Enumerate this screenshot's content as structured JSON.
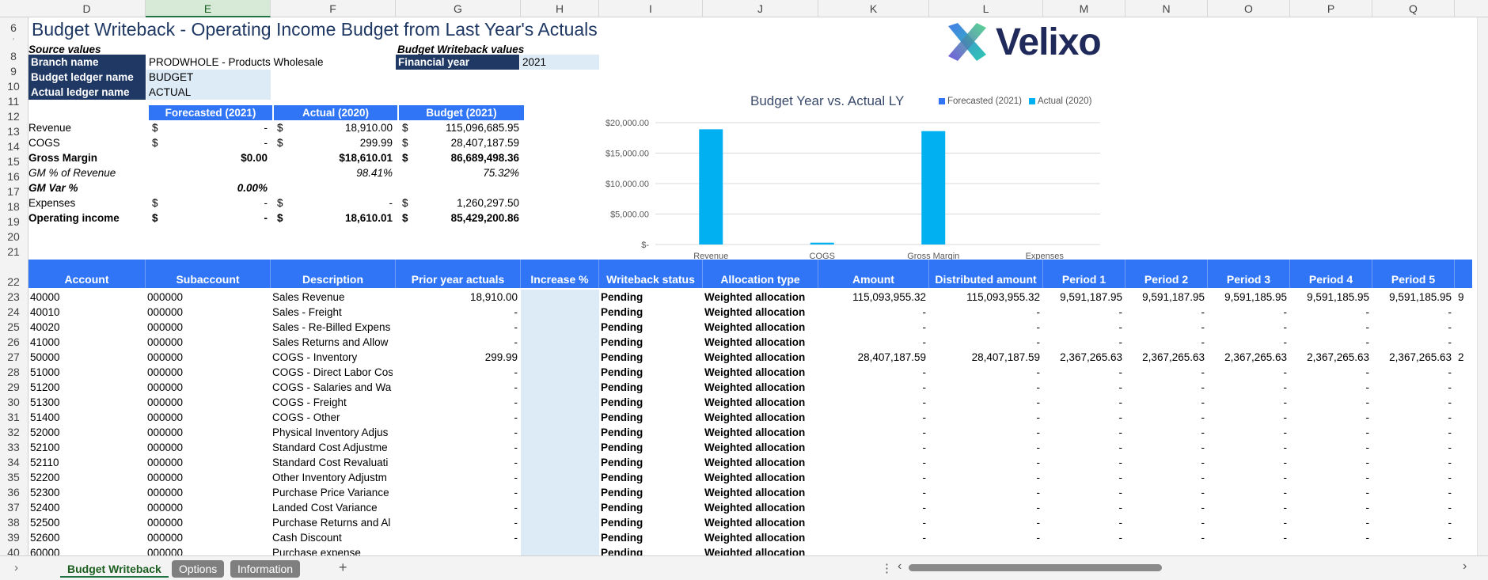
{
  "columns": [
    "D",
    "E",
    "F",
    "G",
    "H",
    "I",
    "J",
    "K",
    "L",
    "M",
    "N",
    "O",
    "P",
    "Q"
  ],
  "rows": [
    "6",
    "7",
    "8",
    "9",
    "10",
    "11",
    "12",
    "13",
    "14",
    "15",
    "16",
    "17",
    "18",
    "19",
    "20",
    "21",
    "22",
    "23",
    "24",
    "25",
    "26",
    "27",
    "28",
    "29",
    "30",
    "31",
    "32",
    "33",
    "34",
    "35",
    "36",
    "37",
    "38",
    "39",
    "40"
  ],
  "title": "Budget Writeback - Operating Income Budget from Last Year's Actuals",
  "logo": {
    "text": "Velixo"
  },
  "source": {
    "heading": "Source values",
    "branch_label": "Branch name",
    "branch_value": "PRODWHOLE - Products Wholesale",
    "budget_ledger_label": "Budget ledger name",
    "budget_ledger_value": "BUDGET",
    "actual_ledger_label": "Actual ledger name",
    "actual_ledger_value": "ACTUAL"
  },
  "writeback": {
    "heading": "Budget Writeback values",
    "fy_label": "Financial year",
    "fy_value": "2021"
  },
  "summary": {
    "headers": [
      "Forecasted (2021)",
      "Actual (2020)",
      "Budget (2021)"
    ],
    "rows": [
      {
        "label": "Revenue",
        "f_cur": "$",
        "f": "-",
        "a_cur": "$",
        "a": "18,910.00",
        "b_cur": "$",
        "b": "115,096,685.95",
        "bold": false,
        "italic": false
      },
      {
        "label": "COGS",
        "f_cur": "$",
        "f": "-",
        "a_cur": "$",
        "a": "299.99",
        "b_cur": "$",
        "b": "28,407,187.59",
        "bold": false,
        "italic": false
      },
      {
        "label": "Gross Margin",
        "f_cur": "",
        "f": "$0.00",
        "a_cur": "",
        "a": "$18,610.01",
        "b_cur": "$",
        "b": "86,689,498.36",
        "bold": true,
        "italic": false
      },
      {
        "label": "GM % of Revenue",
        "f_cur": "",
        "f": "",
        "a_cur": "",
        "a": "98.41%",
        "b_cur": "",
        "b": "75.32%",
        "bold": false,
        "italic": true
      },
      {
        "label": "GM Var %",
        "f_cur": "",
        "f": "0.00%",
        "a_cur": "",
        "a": "",
        "b_cur": "",
        "b": "",
        "bold": true,
        "italic": true
      },
      {
        "label": "Expenses",
        "f_cur": "$",
        "f": "-",
        "a_cur": "$",
        "a": "-",
        "b_cur": "$",
        "b": "1,260,297.50",
        "bold": false,
        "italic": false
      },
      {
        "label": "Operating income",
        "f_cur": "$",
        "f": "-",
        "a_cur": "$",
        "a": "18,610.01",
        "b_cur": "$",
        "b": "85,429,200.86",
        "bold": true,
        "italic": false
      }
    ]
  },
  "chart_data": {
    "type": "bar",
    "title": "Budget Year vs. Actual LY",
    "categories": [
      "Revenue",
      "COGS",
      "Gross Margin",
      "Expenses"
    ],
    "series": [
      {
        "name": "Forecasted (2021)",
        "values": [
          0,
          0,
          0,
          0
        ],
        "color": "#2f75f5"
      },
      {
        "name": "Actual (2020)",
        "values": [
          18910.0,
          299.99,
          18610.01,
          0
        ],
        "color": "#00b0f0"
      }
    ],
    "y_ticks": [
      "$20,000.00",
      "$15,000.00",
      "$10,000.00",
      "$5,000.00",
      "$-"
    ],
    "ylim": [
      0,
      20000
    ],
    "legend": "top-right",
    "grid": true
  },
  "table": {
    "headers": [
      "Account",
      "Subaccount",
      "Description",
      "Prior year actuals",
      "Increase %",
      "Writeback status",
      "Allocation type",
      "Amount",
      "Distributed amount",
      "Period 1",
      "Period 2",
      "Period 3",
      "Period 4",
      "Period 5"
    ],
    "rows": [
      [
        "40000",
        "000000",
        "Sales Revenue",
        "18,910.00",
        "",
        "Pending",
        "Weighted allocation",
        "115,093,955.32",
        "115,093,955.32",
        "9,591,187.95",
        "9,591,187.95",
        "9,591,185.95",
        "9,591,185.95",
        "9,591,185.95"
      ],
      [
        "40010",
        "000000",
        "Sales - Freight",
        "-",
        "",
        "Pending",
        "Weighted allocation",
        "-",
        "-",
        "-",
        "-",
        "-",
        "-",
        "-"
      ],
      [
        "40020",
        "000000",
        "Sales - Re-Billed Expens",
        "-",
        "",
        "Pending",
        "Weighted allocation",
        "-",
        "-",
        "-",
        "-",
        "-",
        "-",
        "-"
      ],
      [
        "41000",
        "000000",
        "Sales Returns and Allow",
        "-",
        "",
        "Pending",
        "Weighted allocation",
        "-",
        "-",
        "-",
        "-",
        "-",
        "-",
        "-"
      ],
      [
        "50000",
        "000000",
        "COGS - Inventory",
        "299.99",
        "",
        "Pending",
        "Weighted allocation",
        "28,407,187.59",
        "28,407,187.59",
        "2,367,265.63",
        "2,367,265.63",
        "2,367,265.63",
        "2,367,265.63",
        "2,367,265.63"
      ],
      [
        "51000",
        "000000",
        "COGS - Direct Labor Cos",
        "-",
        "",
        "Pending",
        "Weighted allocation",
        "-",
        "-",
        "-",
        "-",
        "-",
        "-",
        "-"
      ],
      [
        "51200",
        "000000",
        "COGS - Salaries and Wa",
        "-",
        "",
        "Pending",
        "Weighted allocation",
        "-",
        "-",
        "-",
        "-",
        "-",
        "-",
        "-"
      ],
      [
        "51300",
        "000000",
        "COGS - Freight",
        "-",
        "",
        "Pending",
        "Weighted allocation",
        "-",
        "-",
        "-",
        "-",
        "-",
        "-",
        "-"
      ],
      [
        "51400",
        "000000",
        "COGS - Other",
        "-",
        "",
        "Pending",
        "Weighted allocation",
        "-",
        "-",
        "-",
        "-",
        "-",
        "-",
        "-"
      ],
      [
        "52000",
        "000000",
        "Physical Inventory Adjus",
        "-",
        "",
        "Pending",
        "Weighted allocation",
        "-",
        "-",
        "-",
        "-",
        "-",
        "-",
        "-"
      ],
      [
        "52100",
        "000000",
        "Standard Cost Adjustme",
        "-",
        "",
        "Pending",
        "Weighted allocation",
        "-",
        "-",
        "-",
        "-",
        "-",
        "-",
        "-"
      ],
      [
        "52110",
        "000000",
        "Standard Cost Revaluati",
        "-",
        "",
        "Pending",
        "Weighted allocation",
        "-",
        "-",
        "-",
        "-",
        "-",
        "-",
        "-"
      ],
      [
        "52200",
        "000000",
        "Other Inventory Adjustm",
        "-",
        "",
        "Pending",
        "Weighted allocation",
        "-",
        "-",
        "-",
        "-",
        "-",
        "-",
        "-"
      ],
      [
        "52300",
        "000000",
        "Purchase Price Variance",
        "-",
        "",
        "Pending",
        "Weighted allocation",
        "-",
        "-",
        "-",
        "-",
        "-",
        "-",
        "-"
      ],
      [
        "52400",
        "000000",
        "Landed Cost Variance",
        "-",
        "",
        "Pending",
        "Weighted allocation",
        "-",
        "-",
        "-",
        "-",
        "-",
        "-",
        "-"
      ],
      [
        "52500",
        "000000",
        "Purchase Returns and Al",
        "-",
        "",
        "Pending",
        "Weighted allocation",
        "-",
        "-",
        "-",
        "-",
        "-",
        "-",
        "-"
      ],
      [
        "52600",
        "000000",
        "Cash Discount",
        "-",
        "",
        "Pending",
        "Weighted allocation",
        "-",
        "-",
        "-",
        "-",
        "-",
        "-",
        "-"
      ],
      [
        "60000",
        "000000",
        "Purchase expense",
        "",
        "",
        "Pending",
        "Weighted allocation",
        "",
        "",
        "",
        "",
        "",
        "",
        ""
      ]
    ],
    "overflow_marks": [
      "9",
      "2"
    ]
  },
  "sheet_tabs": {
    "active": "Budget Writeback",
    "others": [
      "Options",
      "Information"
    ],
    "add": "+",
    "more": "⋮",
    "prev": "‹",
    "next": "›"
  }
}
